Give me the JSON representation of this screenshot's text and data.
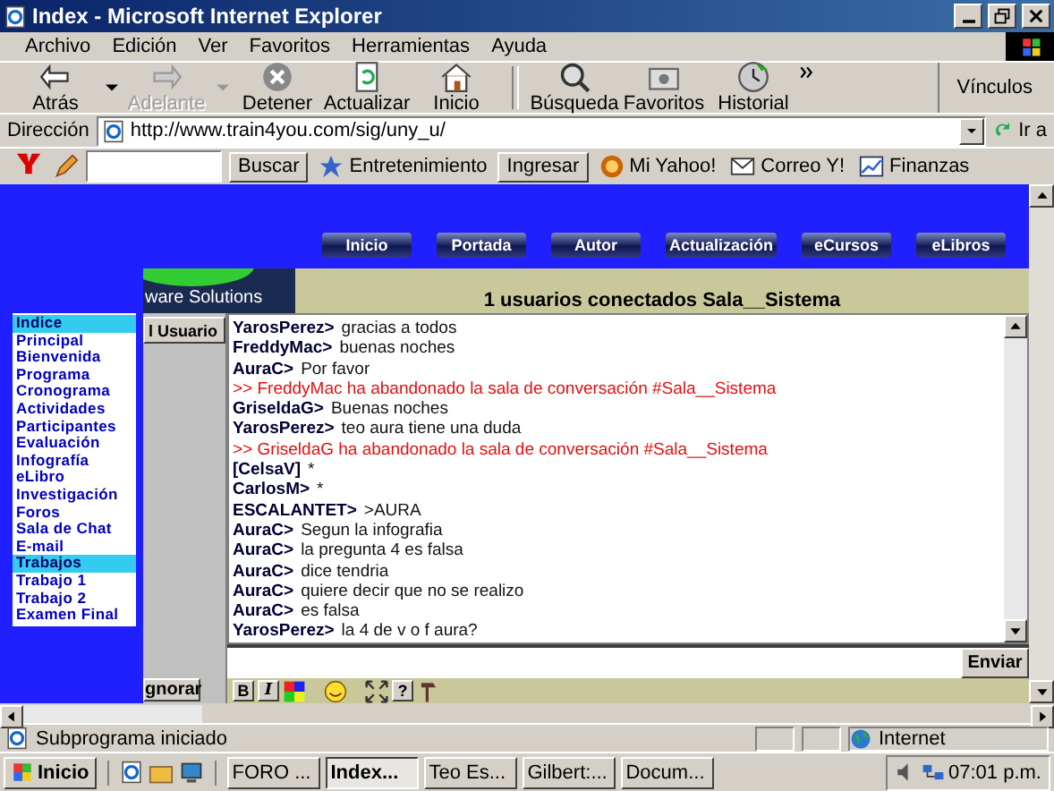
{
  "window": {
    "title": "Index - Microsoft Internet Explorer"
  },
  "menu": [
    "Archivo",
    "Edición",
    "Ver",
    "Favoritos",
    "Herramientas",
    "Ayuda"
  ],
  "toolbar": [
    {
      "label": "Atrás",
      "kind": "back",
      "disabled": false,
      "dropdown": true
    },
    {
      "label": "Adelante",
      "kind": "forward",
      "disabled": true,
      "dropdown": true
    },
    {
      "label": "Detener",
      "kind": "stop",
      "disabled": false,
      "dropdown": false
    },
    {
      "label": "Actualizar",
      "kind": "refresh",
      "disabled": false,
      "dropdown": false
    },
    {
      "label": "Inicio",
      "kind": "home",
      "disabled": false,
      "dropdown": false
    },
    {
      "label": "Búsqueda",
      "kind": "search",
      "disabled": false,
      "dropdown": false
    },
    {
      "label": "Favoritos",
      "kind": "favorites",
      "disabled": false,
      "dropdown": false
    },
    {
      "label": "Historial",
      "kind": "history",
      "disabled": false,
      "dropdown": false
    }
  ],
  "links_label": "Vínculos",
  "address": {
    "label": "Dirección",
    "value": "http://www.train4you.com/sig/uny_u/",
    "go": "Ir a"
  },
  "yahoo_bar": {
    "search_button": "Buscar",
    "items": [
      {
        "label": "Entretenimiento",
        "kind": "star"
      },
      {
        "label": "Ingresar",
        "kind": "button"
      },
      {
        "label": "Mi Yahoo!",
        "kind": "my"
      },
      {
        "label": "Correo Y!",
        "kind": "mail"
      },
      {
        "label": "Finanzas",
        "kind": "chart"
      }
    ]
  },
  "nav": [
    "Inicio",
    "Portada",
    "Autor",
    "Actualización",
    "eCursos",
    "eLibros"
  ],
  "logo_text": "ware Solutions",
  "sidebar": {
    "items": [
      {
        "label": "Indice",
        "selected": true
      },
      {
        "label": "Principal",
        "selected": false
      },
      {
        "label": "Bienvenida",
        "selected": false
      },
      {
        "label": "Programa",
        "selected": false
      },
      {
        "label": "Cronograma",
        "selected": false
      },
      {
        "label": "Actividades",
        "selected": false
      },
      {
        "label": "Participantes",
        "selected": false
      },
      {
        "label": "Evaluación",
        "selected": false
      },
      {
        "label": "Infografía",
        "selected": false
      },
      {
        "label": "eLibro",
        "selected": false
      },
      {
        "label": "Investigación",
        "selected": false
      },
      {
        "label": "Foros",
        "selected": false
      },
      {
        "label": "Sala de Chat",
        "selected": false
      },
      {
        "label": "E-mail",
        "selected": false
      },
      {
        "label": "Trabajos",
        "selected": true
      },
      {
        "label": "Trabajo 1",
        "selected": false
      },
      {
        "label": "Trabajo 2",
        "selected": false
      },
      {
        "label": "Examen Final",
        "selected": false
      }
    ]
  },
  "chat": {
    "header": "1 usuarios conectados Sala__Sistema",
    "user_button": "l Usuario",
    "ignore_button": "gnorar",
    "send_button": "Enviar",
    "messages": [
      {
        "kind": "user",
        "name": "YarosPerez>",
        "text": "gracias  a todos"
      },
      {
        "kind": "user",
        "name": "FreddyMac>",
        "text": "buenas noches"
      },
      {
        "kind": "user",
        "name": "AuraC>",
        "text": "Por favor"
      },
      {
        "kind": "system",
        "text": ">> FreddyMac ha abandonado la sala de conversación #Sala__Sistema"
      },
      {
        "kind": "user",
        "name": "GriseldaG>",
        "text": "Buenas noches"
      },
      {
        "kind": "user",
        "name": "YarosPerez>",
        "text": "teo aura tiene una duda"
      },
      {
        "kind": "system",
        "text": ">> GriseldaG ha abandonado la sala de conversación #Sala__Sistema"
      },
      {
        "kind": "user",
        "name": "[CelsaV]",
        "text": "*"
      },
      {
        "kind": "user",
        "name": "CarlosM>",
        "text": "*"
      },
      {
        "kind": "user",
        "name": "ESCALANTET>",
        "text": ">AURA"
      },
      {
        "kind": "user",
        "name": "AuraC>",
        "text": "Segun la infografia"
      },
      {
        "kind": "user",
        "name": "AuraC>",
        "text": "la pregunta 4 es falsa"
      },
      {
        "kind": "user",
        "name": "AuraC>",
        "text": "dice tendria"
      },
      {
        "kind": "user",
        "name": "AuraC>",
        "text": "quiere decir que no se realizo"
      },
      {
        "kind": "user",
        "name": "AuraC>",
        "text": "es falsa"
      },
      {
        "kind": "user",
        "name": "YarosPerez>",
        "text": "la 4 de v o f  aura?"
      }
    ],
    "format_tools": [
      {
        "label": "B",
        "kind": "bold"
      },
      {
        "label": "I",
        "kind": "italic"
      },
      {
        "kind": "color"
      },
      {
        "kind": "smiley"
      },
      {
        "kind": "expand"
      },
      {
        "label": "?",
        "kind": "help"
      },
      {
        "kind": "tool"
      }
    ]
  },
  "status_bar": {
    "text": "Subprograma iniciado",
    "zone": "Internet"
  },
  "taskbar": {
    "start": "Inicio",
    "tasks": [
      {
        "label": "FORO ...",
        "selected": false
      },
      {
        "label": "Index...",
        "selected": true
      },
      {
        "label": "Teo Es...",
        "selected": false
      },
      {
        "label": "Gilbert:...",
        "selected": false
      },
      {
        "label": "Docum...",
        "selected": false
      }
    ],
    "clock": "07:01 p.m."
  }
}
